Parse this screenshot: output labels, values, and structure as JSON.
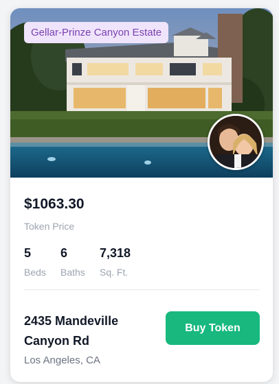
{
  "property": {
    "badge": "Gellar-Prinze Canyon Estate",
    "price": "$1063.30",
    "price_label": "Token Price",
    "stats": [
      {
        "value": "5",
        "label": "Beds"
      },
      {
        "value": "6",
        "label": "Baths"
      },
      {
        "value": "7,318",
        "label": "Sq. Ft."
      }
    ],
    "address": "2435 Mandeville Canyon Rd",
    "city": "Los Angeles, CA",
    "buy_label": "Buy Token"
  },
  "colors": {
    "accent_green": "#18b87e",
    "badge_bg": "#efe4fb",
    "badge_text": "#7a3fb0"
  }
}
